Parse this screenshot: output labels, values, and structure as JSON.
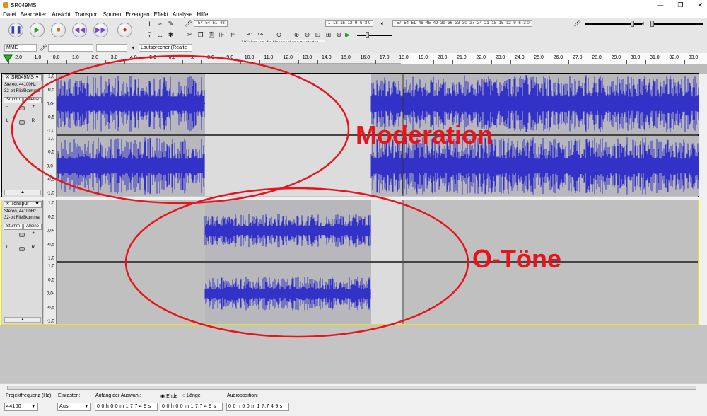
{
  "window": {
    "title": "SR049MS",
    "min_glyph": "—",
    "max_glyph": "❐",
    "close_glyph": "✕"
  },
  "menu": [
    "Datei",
    "Bearbeiten",
    "Ansicht",
    "Transport",
    "Spuren",
    "Erzeugen",
    "Effekt",
    "Analyse",
    "Hilfe"
  ],
  "meters": {
    "record_scale": "-57 -54 -51 -48",
    "record_channels": "L\nR",
    "monitor_hint": "Klicken um die Überwachung zu starten",
    "record_scale_tail": "1 -18 -15 -12 -9 -6 -3 0",
    "play_scale": "-57 -54 -51 -48 -45 -42 -39 -36 -33 -30 -27 -24 -21 -18 -15 -12 -9 -6 -3 0"
  },
  "device_bar": {
    "host": "MME",
    "output": "Lautsprecher (Realte"
  },
  "ruler": {
    "ticks": [
      "-2,0",
      "-1,0",
      "0,0",
      "1,0",
      "2,0",
      "3,0",
      "4,0",
      "5,0",
      "6,0",
      "7,0",
      "8,0",
      "9,0",
      "10,0",
      "11,0",
      "12,0",
      "13,0",
      "14,0",
      "15,0",
      "16,0",
      "17,0",
      "18,0",
      "19,0",
      "20,0",
      "21,0",
      "22,0",
      "23,0",
      "24,0",
      "25,0",
      "26,0",
      "27,0",
      "28,0",
      "29,0",
      "30,0",
      "31,0",
      "32,0",
      "33,0"
    ]
  },
  "tracks": [
    {
      "name": "SR049MS",
      "info1": "Stereo, 44100Hz",
      "info2": "32-bit Fließkomma",
      "mute": "Stumm",
      "solo": "Alleine",
      "gain_l": "-",
      "gain_r": "+",
      "pan_l": "L",
      "pan_r": "R"
    },
    {
      "name": "Tonspur",
      "info1": "Stereo, 44100Hz",
      "info2": "32-bit Fließkomma",
      "mute": "Stumm",
      "solo": "Alleine",
      "gain_l": "-",
      "gain_r": "+",
      "pan_l": "L",
      "pan_r": "R"
    }
  ],
  "vscale": [
    "1,0",
    "0,5",
    "0,0-",
    "-0,5",
    "-1,0"
  ],
  "annotations": {
    "moderation": "Moderation",
    "otoene": "O-Töne",
    "color": "#e8141c"
  },
  "selection_bar": {
    "rate_label": "Projektfrequenz (Hz):",
    "rate_value": "44100",
    "snap_label": "Einrasten:",
    "snap_value": "Aus",
    "start_label": "Anfang der Auswahl:",
    "end_radio": "Ende",
    "length_radio": "Länge",
    "start_value": "0 0 h 0 0 m 1 7.7 4 9 s",
    "end_value": "0 0 h 0 0 m 1 7.7 4 9 s",
    "pos_label": "Audioposition:",
    "pos_value": "0 0 h 0 0 m 1 7.7 4 9 s"
  },
  "colors": {
    "wave": "#3232c8",
    "accent_selection": "#e8e020"
  }
}
